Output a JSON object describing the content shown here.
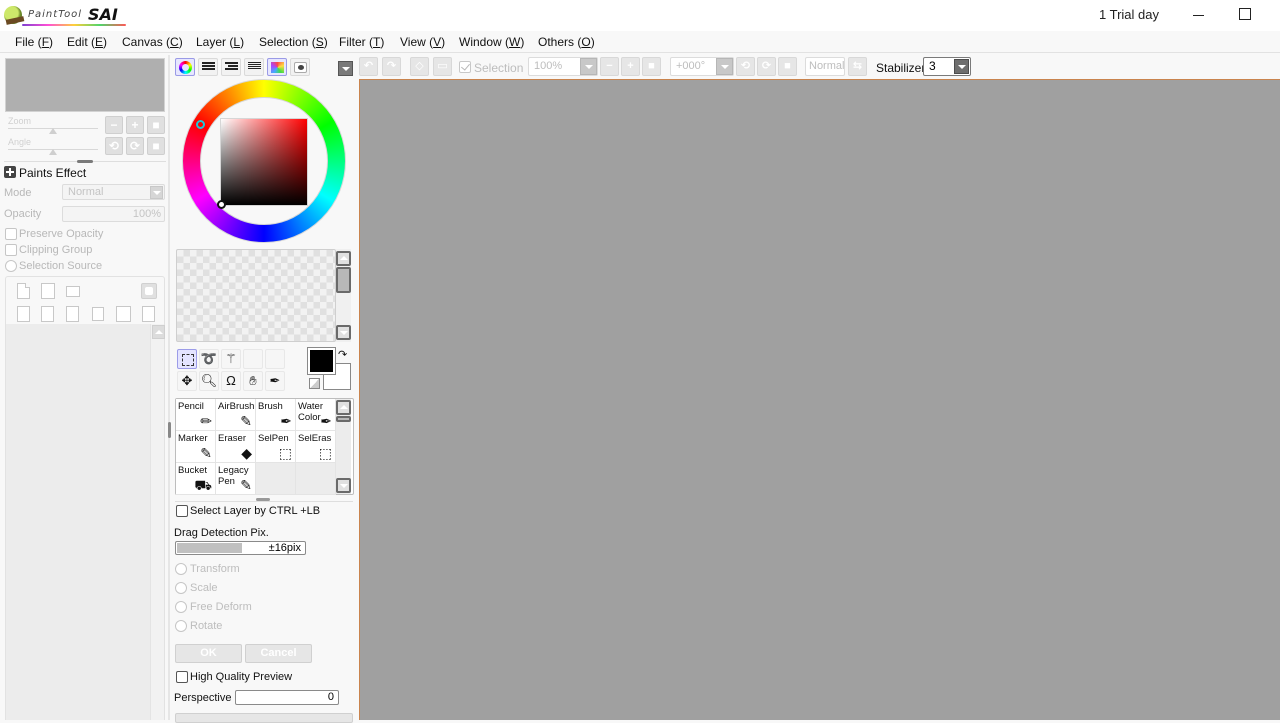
{
  "app": {
    "logo_text": "PaintTool",
    "logo_brand": "SAI",
    "trial_text": "1 Trial day"
  },
  "menu": [
    {
      "label": "File",
      "key": "F"
    },
    {
      "label": "Edit",
      "key": "E"
    },
    {
      "label": "Canvas",
      "key": "C"
    },
    {
      "label": "Layer",
      "key": "L"
    },
    {
      "label": "Selection",
      "key": "S"
    },
    {
      "label": "Filter",
      "key": "T"
    },
    {
      "label": "View",
      "key": "V"
    },
    {
      "label": "Window",
      "key": "W"
    },
    {
      "label": "Others",
      "key": "O"
    }
  ],
  "toolbar": {
    "selection_label": "Selection",
    "selection_checked": true,
    "zoom_value": "100%",
    "angle_value": "+000°",
    "blend_value": "Normal",
    "stabilizer_label": "Stabilizer",
    "stabilizer_value": "3"
  },
  "navigator": {
    "zoom_label": "Zoom",
    "angle_label": "Angle"
  },
  "layer_props": {
    "paints_effect_label": "Paints Effect",
    "mode_label": "Mode",
    "mode_value": "Normal",
    "opacity_label": "Opacity",
    "opacity_value": "100%",
    "preserve_opacity_label": "Preserve Opacity",
    "clipping_group_label": "Clipping Group",
    "selection_source_label": "Selection Source"
  },
  "color": {
    "foreground": "#000000",
    "background": "#ffffff",
    "hue_marker": "#1ec8d8",
    "modes": [
      "color-wheel",
      "rgb-sliders",
      "hsv-sliders",
      "intermediate-slider",
      "color-swatches",
      "scratch-pad"
    ]
  },
  "selection_tools": [
    {
      "name": "rect-select",
      "glyph": ""
    },
    {
      "name": "lasso",
      "glyph": "➰"
    },
    {
      "name": "magic-wand",
      "glyph": "⚚"
    },
    {
      "name": "empty-slot-1",
      "glyph": ""
    },
    {
      "name": "empty-slot-2",
      "glyph": ""
    },
    {
      "name": "move",
      "glyph": "✥"
    },
    {
      "name": "zoom",
      "glyph": "🔍︎"
    },
    {
      "name": "rotate",
      "glyph": "Ω"
    },
    {
      "name": "hand",
      "glyph": "✋︎"
    },
    {
      "name": "eyedropper",
      "glyph": "✒"
    }
  ],
  "brushes": [
    {
      "label": "Pencil",
      "glyph": "✏"
    },
    {
      "label": "AirBrush",
      "glyph": "✎"
    },
    {
      "label": "Brush",
      "glyph": "✒"
    },
    {
      "label": "Water\nColor",
      "glyph": "✒"
    },
    {
      "label": "Marker",
      "glyph": "✎"
    },
    {
      "label": "Eraser",
      "glyph": "◆"
    },
    {
      "label": "SelPen",
      "glyph": "⬚"
    },
    {
      "label": "SelEras",
      "glyph": "⬚"
    },
    {
      "label": "Bucket",
      "glyph": "⛟"
    },
    {
      "label": "Legacy\nPen",
      "glyph": "✎"
    },
    {
      "label": "",
      "glyph": ""
    },
    {
      "label": "",
      "glyph": ""
    }
  ],
  "tool_options": {
    "select_layer_label": "Select Layer by CTRL +LB",
    "drag_detection_label": "Drag Detection Pix.",
    "drag_detection_value": "±16pix",
    "drag_detection_fraction": 0.5,
    "transform_label": "Transform",
    "scale_label": "Scale",
    "free_deform_label": "Free Deform",
    "rotate_label": "Rotate",
    "ok_label": "OK",
    "cancel_label": "Cancel",
    "hq_preview_label": "High Quality Preview",
    "perspective_label": "Perspective",
    "perspective_value": "0"
  }
}
